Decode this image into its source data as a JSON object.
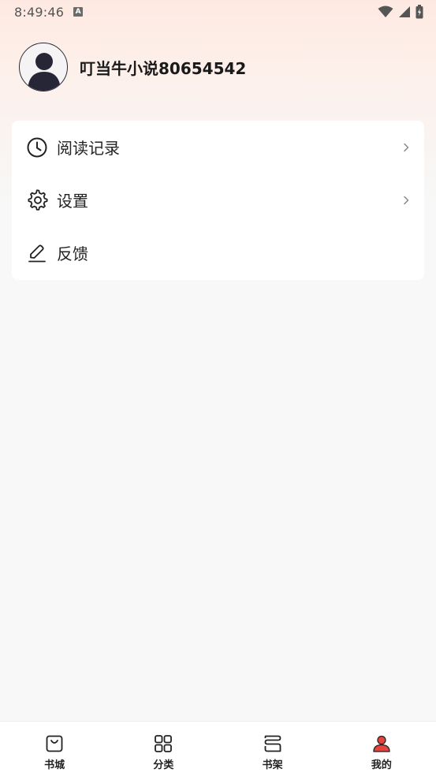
{
  "status_bar": {
    "time": "8:49:46",
    "notification_badge": "A"
  },
  "profile": {
    "username": "叮当牛小说80654542"
  },
  "menu": [
    {
      "label": "阅读记录",
      "icon": "clock-icon",
      "has_chevron": true
    },
    {
      "label": "设置",
      "icon": "gear-icon",
      "has_chevron": true
    },
    {
      "label": "反馈",
      "icon": "edit-icon",
      "has_chevron": false
    }
  ],
  "tabbar": {
    "tabs": [
      {
        "label": "书城",
        "icon": "bag-icon",
        "active": false
      },
      {
        "label": "分类",
        "icon": "grid-icon",
        "active": false
      },
      {
        "label": "书架",
        "icon": "bookshelf-icon",
        "active": false
      },
      {
        "label": "我的",
        "icon": "user-icon",
        "active": true
      }
    ]
  },
  "colors": {
    "active_accent": "#e8423f",
    "text_primary": "#222222",
    "header_gradient_top": "#fde9e2"
  }
}
